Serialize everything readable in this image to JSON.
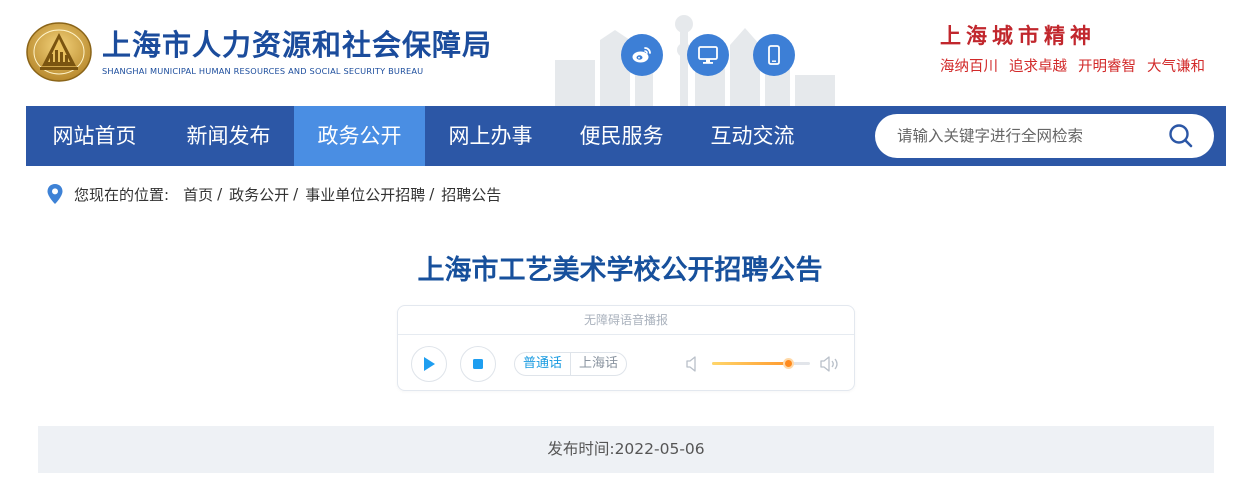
{
  "header": {
    "logo_cn": "上海市人力资源和社会保障局",
    "logo_en": "SHANGHAI MUNICIPAL HUMAN RESOURCES AND SOCIAL SECURITY BUREAU",
    "social": [
      {
        "name": "weibo-icon"
      },
      {
        "name": "monitor-icon"
      },
      {
        "name": "mobile-icon"
      }
    ],
    "spirit_title": "上海城市精神",
    "spirit_phrases": [
      "海纳百川",
      "追求卓越",
      "开明睿智",
      "大气谦和"
    ]
  },
  "nav": {
    "items": [
      {
        "label": "网站首页",
        "active": false
      },
      {
        "label": "新闻发布",
        "active": false
      },
      {
        "label": "政务公开",
        "active": true
      },
      {
        "label": "网上办事",
        "active": false
      },
      {
        "label": "便民服务",
        "active": false
      },
      {
        "label": "互动交流",
        "active": false
      }
    ],
    "search_placeholder": "请输入关键字进行全网检索"
  },
  "breadcrumb": {
    "prefix": "您现在的位置:",
    "items": [
      "首页",
      "政务公开",
      "事业单位公开招聘",
      "招聘公告"
    ],
    "separator": "/"
  },
  "article": {
    "title": "上海市工艺美术学校公开招聘公告",
    "publish_label": "发布时间:",
    "publish_date": "2022-05-06"
  },
  "player": {
    "label": "无障碍语音播报",
    "languages": [
      {
        "label": "普通话",
        "active": true
      },
      {
        "label": "上海话",
        "active": false
      }
    ],
    "volume": 0.78
  },
  "colors": {
    "brand_blue": "#1b4c9c",
    "nav_bg": "#2c57a6",
    "nav_active": "#4a8ee3",
    "spirit_red": "#d22a2a",
    "player_accent": "#1a9be0"
  }
}
